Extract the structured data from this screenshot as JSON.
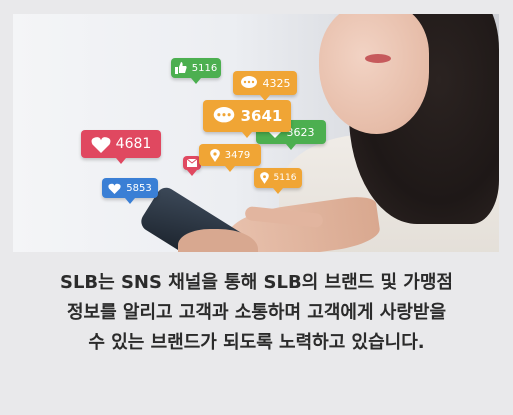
{
  "photo": {
    "badges": [
      {
        "id": "likes-top",
        "value": "5116",
        "icon": "thumbs-up-icon"
      },
      {
        "id": "comments-small",
        "value": "4325",
        "icon": "speech-bubble-icon"
      },
      {
        "id": "comments-big",
        "value": "3641",
        "icon": "speech-bubble-icon"
      },
      {
        "id": "green-count",
        "value": "3623",
        "icon": "heart-icon"
      },
      {
        "id": "hearts-red",
        "value": "4681",
        "icon": "heart-icon"
      },
      {
        "id": "location-mid",
        "value": "3479",
        "icon": "map-pin-icon"
      },
      {
        "id": "location-right",
        "value": "5116",
        "icon": "map-pin-icon"
      },
      {
        "id": "hearts-blue",
        "value": "5853",
        "icon": "heart-icon"
      }
    ]
  },
  "caption": {
    "line1": "SLB는 SNS 채널을 통해 SLB의 브랜드 및 가맹점",
    "line2": "정보를 알리고 고객과 소통하며 고객에게 사랑받을",
    "line3": "수 있는 브랜드가 되도록 노력하고 있습니다."
  },
  "colors": {
    "green": "#4caf50",
    "orange": "#f0a535",
    "red": "#e04860",
    "blue": "#3a7fd5"
  }
}
